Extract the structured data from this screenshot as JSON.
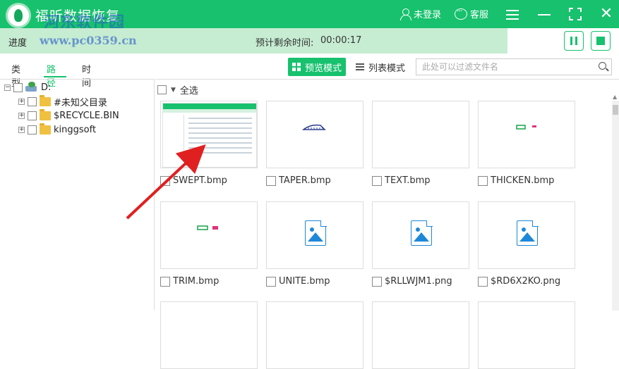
{
  "window": {
    "title": "福昕数据恢复",
    "watermark": "河东软件园",
    "user_label": "未登录",
    "service_label": "客服",
    "accent": "#17c16d"
  },
  "progress": {
    "label": "进度",
    "watermark": "www.pc0359.cn",
    "remaining_label": "预计剩余时间:",
    "remaining_time": "00:00:17",
    "fraction": 0.82
  },
  "tabs": [
    {
      "label": "类型",
      "active": false
    },
    {
      "label": "路径",
      "active": true
    },
    {
      "label": "时间",
      "active": false
    }
  ],
  "view": {
    "preview_label": "预览模式",
    "list_label": "列表模式",
    "search_placeholder": "此处可以过滤文件名"
  },
  "tree": [
    {
      "label": "D:",
      "icon": "drive-icon",
      "level": 0,
      "expander": "−"
    },
    {
      "label": "#未知父目录",
      "icon": "folder-icon",
      "level": 1,
      "expander": "+"
    },
    {
      "label": "$RECYCLE.BIN",
      "icon": "folder-icon",
      "level": 1,
      "expander": "+"
    },
    {
      "label": "kinggsoft",
      "icon": "folder-icon",
      "level": 1,
      "expander": "+"
    }
  ],
  "content": {
    "select_all_label": "全选"
  },
  "files": [
    {
      "name": "SWEPT.bmp",
      "thumb": "screenshot"
    },
    {
      "name": "TAPER.bmp",
      "thumb": "shape-blue"
    },
    {
      "name": "TEXT.bmp",
      "thumb": "blank"
    },
    {
      "name": "THICKEN.bmp",
      "thumb": "shape-green"
    },
    {
      "name": "TRIM.bmp",
      "thumb": "shape-green-pink"
    },
    {
      "name": "UNITE.bmp",
      "thumb": "image-icon"
    },
    {
      "name": "$RLLWJM1.png",
      "thumb": "image-icon"
    },
    {
      "name": "$RD6X2KO.png",
      "thumb": "image-icon"
    }
  ]
}
